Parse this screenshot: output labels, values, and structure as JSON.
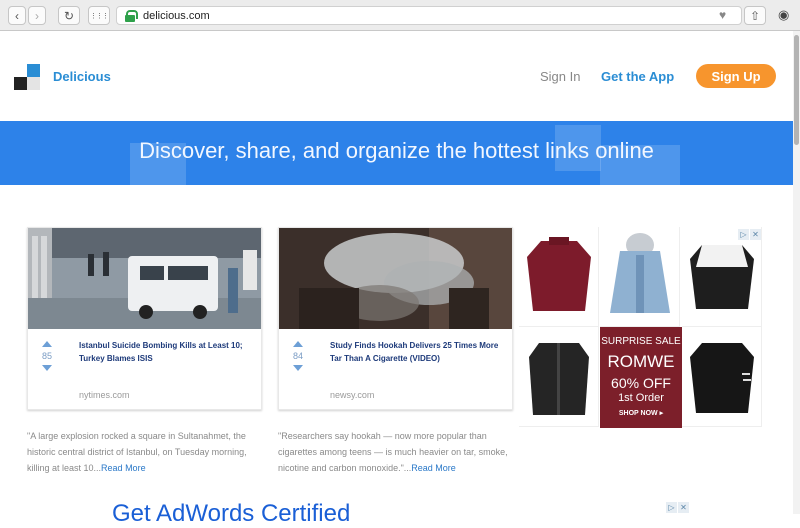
{
  "browser": {
    "url": "delicious.com",
    "back_glyph": "‹",
    "forward_glyph": "›",
    "reload_glyph": "↻",
    "grid_glyph": "⋮⋮⋮",
    "heart_glyph": "♥",
    "share_glyph": "⇧",
    "user_glyph": "◉"
  },
  "header": {
    "brand": "Delicious",
    "sign_in": "Sign In",
    "get_app": "Get the App",
    "sign_up": "Sign Up"
  },
  "banner": {
    "text": "Discover, share, and organize the hottest links online"
  },
  "cards": [
    {
      "votes": "85",
      "title": "Istanbul Suicide Bombing Kills at Least 10; Turkey Blames ISIS",
      "source": "nytimes.com",
      "excerpt": "\"A large explosion rocked a square in Sultanahmet, the historic central district of Istanbul, on Tuesday morning, killing at least 10...",
      "read_more": "Read More"
    },
    {
      "votes": "84",
      "title": "Study Finds Hookah Delivers 25 Times More Tar Than A Cigarette (VIDEO)",
      "source": "newsy.com",
      "excerpt": "\"Researchers say hookah — now more popular than cigarettes among teens — is much heavier on tar, smoke, nicotine and carbon monoxide.\"...",
      "read_more": "Read More"
    }
  ],
  "ad": {
    "badge": "▷",
    "close": "✕",
    "promo_line1": "SURPRISE SALE",
    "promo_line2": "ROMWE",
    "promo_line3": "60% OFF",
    "promo_line4": "1st Order",
    "promo_line5": "SHOP NOW ▸"
  },
  "ad2": {
    "headline": "Get AdWords Certified"
  },
  "colors": {
    "brand_blue": "#2a8dd4",
    "banner_blue": "#2d82e9",
    "signup_orange": "#f7952d",
    "promo_red": "#7c1f2a"
  }
}
